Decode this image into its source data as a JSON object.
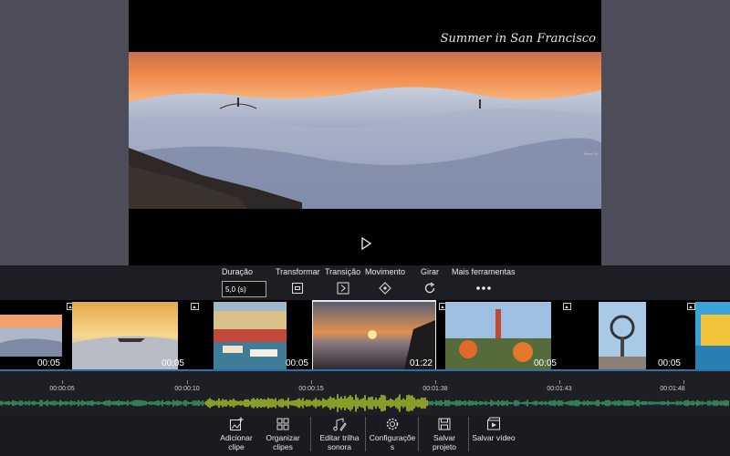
{
  "preview": {
    "title_overlay": "Summer in San Francisco",
    "watermark": "Rend Gr"
  },
  "toolbar": {
    "duration_label": "Duração",
    "duration_value": "5,0 (s)",
    "transform_label": "Transformar",
    "transition_label": "Transição",
    "movement_label": "Movimento",
    "rotate_label": "Girar",
    "more_label": "Mais ferramentas"
  },
  "clips": [
    {
      "duration": "00:05",
      "selected": false
    },
    {
      "duration": "00:05",
      "selected": false
    },
    {
      "duration": "00:05",
      "selected": false
    },
    {
      "duration": "01:22",
      "selected": true
    },
    {
      "duration": "00:05",
      "selected": false
    },
    {
      "duration": "00:05",
      "selected": false
    },
    {
      "duration": "",
      "selected": false
    }
  ],
  "timeline": {
    "labels": [
      "00:00:05",
      "00:00:10",
      "00:00:15",
      "00:01:38",
      "00:01:43",
      "00:01:48"
    ]
  },
  "bottombar": {
    "add_clip": "Adicionar clipe",
    "organize_clips": "Organizar clipes",
    "edit_soundtrack": "Editar trilha sonora",
    "settings": "Configuraçõe s",
    "save_project": "Salvar projeto",
    "save_video": "Salvar vídeo"
  },
  "colors": {
    "accent": "#2e6fa8",
    "waveform_active": "#b5d22a",
    "waveform": "#3aa870"
  }
}
